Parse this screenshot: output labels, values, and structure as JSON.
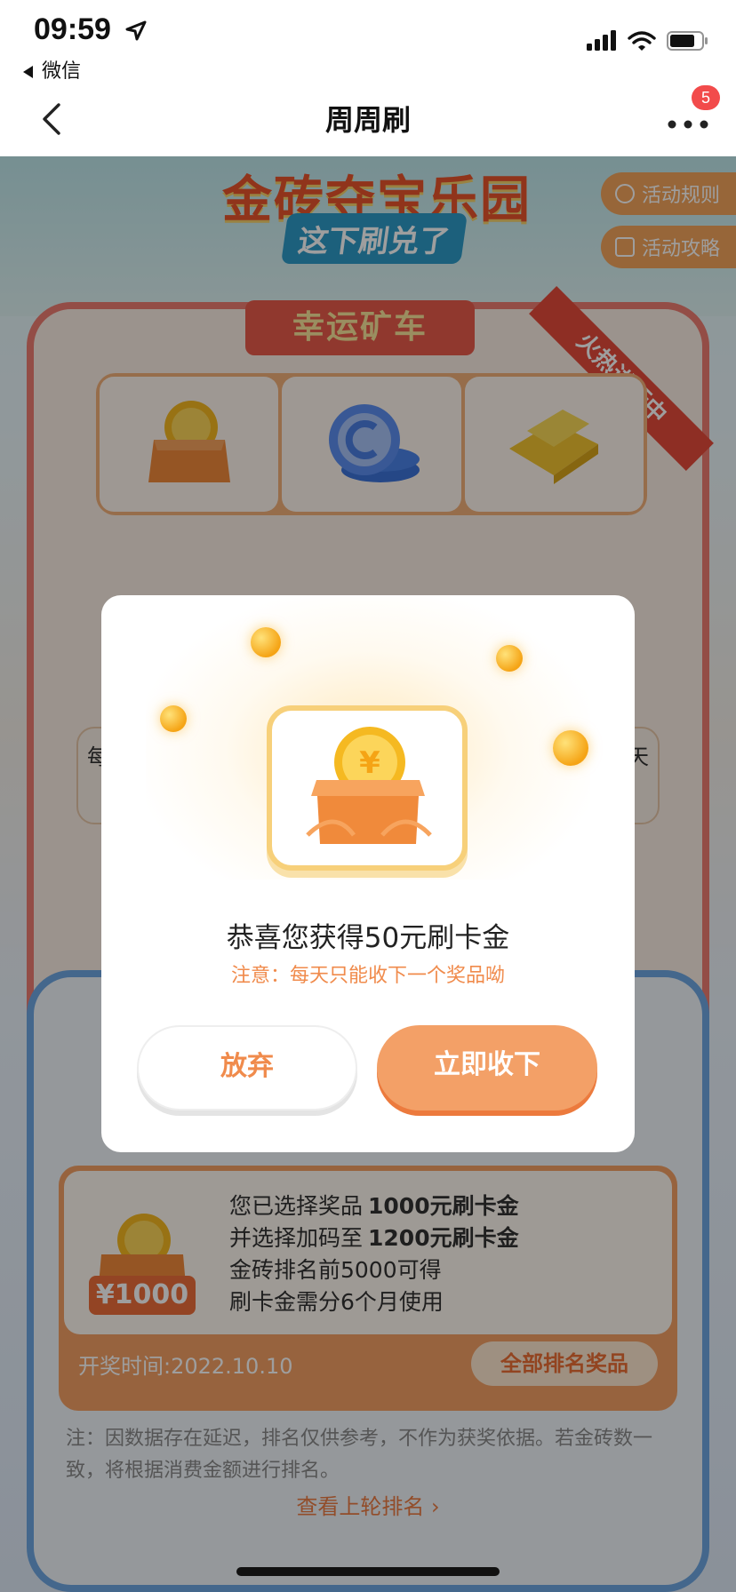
{
  "status_bar": {
    "time": "09:59",
    "back_app": "微信"
  },
  "nav": {
    "title": "周周刷",
    "badge_count": "5"
  },
  "banner": {
    "title": "金砖夺宝乐园",
    "subtitle": "这下刷兑了",
    "rules_label": "活动规则",
    "guide_label": "活动攻略"
  },
  "lucky_cart": {
    "heading": "幸运矿车",
    "ribbon": "火热进行中",
    "select_text_start": "每",
    "select_text_end": "天"
  },
  "prize_info": {
    "amount": "¥1000",
    "line1_prefix": "您已选择奖品",
    "line1_value": "1000元刷卡金",
    "line2_prefix": "并选择加码至",
    "line2_value": "1200元刷卡金",
    "line3": "金砖排名前5000可得",
    "line4": "刷卡金需分6个月使用",
    "draw_time": "开奖时间:2022.10.10",
    "all_ranking_button": "全部排名奖品"
  },
  "note": "注：因数据存在延迟，排名仅供参考，不作为获奖依据。若金砖数一致，将根据消费金额进行排名。",
  "last_round_link": "查看上轮排名",
  "modal": {
    "title": "恭喜您获得50元刷卡金",
    "note": "注意：每天只能收下一个奖品呦",
    "abandon_button": "放弃",
    "accept_button": "立即收下"
  },
  "colors": {
    "accent": "#f3a067",
    "accent_text": "#f08b4c",
    "badge": "#f24b4b"
  }
}
